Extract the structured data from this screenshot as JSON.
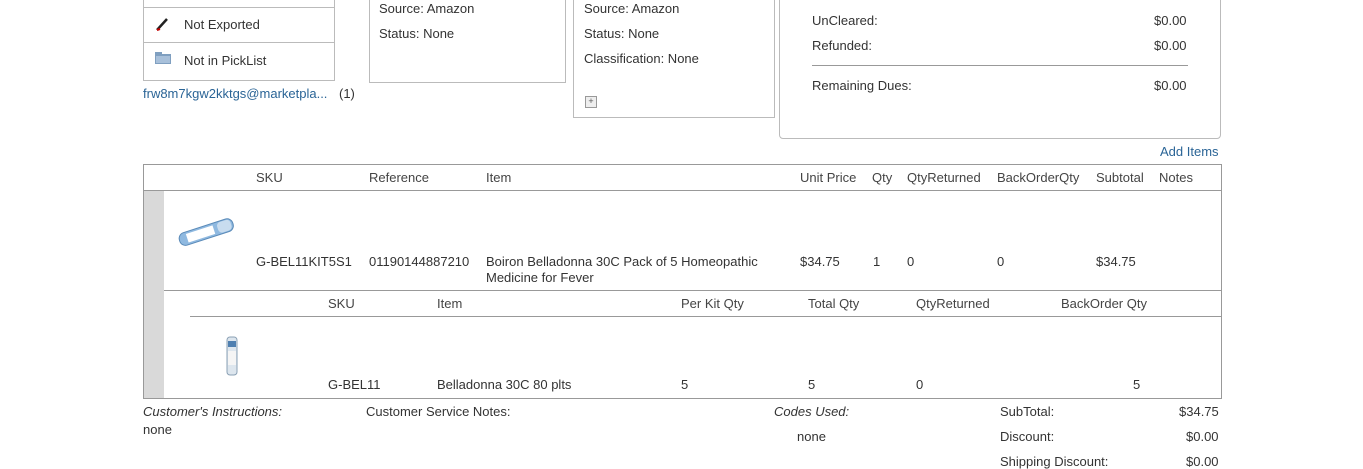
{
  "export_menu": {
    "items": [
      {
        "label": "Not Exported",
        "icon": "pencil-icon"
      },
      {
        "label": "Not in PickList",
        "icon": "folder-icon"
      }
    ],
    "email": "frw8m7kgw2kktgs@marketpla...",
    "email_count": "(1)"
  },
  "order_box": {
    "source": "Source: Amazon",
    "status": "Status: None"
  },
  "customer_box": {
    "source": "Source: Amazon",
    "status": "Status: None",
    "classification": "Classification: None",
    "expand": "+"
  },
  "payment_box": {
    "rows": [
      {
        "label": "UnCleared:",
        "value": "$0.00"
      },
      {
        "label": "Refunded:",
        "value": "$0.00"
      }
    ],
    "remaining_label": "Remaining Dues:",
    "remaining_value": "$0.00"
  },
  "add_items": "Add Items",
  "items_table": {
    "headers": {
      "sku": "SKU",
      "reference": "Reference",
      "item": "Item",
      "unit_price": "Unit Price",
      "qty": "Qty",
      "qty_returned": "QtyReturned",
      "backorder_qty": "BackOrderQty",
      "subtotal": "Subtotal",
      "notes": "Notes"
    },
    "row": {
      "sku": "G-BEL11KIT5S1",
      "reference": "01190144887210",
      "item_line1": "Boiron Belladonna 30C Pack of 5 Homeopathic",
      "item_line2": "Medicine for Fever",
      "unit_price": "$34.75",
      "qty": "1",
      "qty_returned": "0",
      "backorder_qty": "0",
      "subtotal": "$34.75"
    },
    "kit_headers": {
      "sku": "SKU",
      "item": "Item",
      "per_kit_qty": "Per Kit Qty",
      "total_qty": "Total Qty",
      "qty_returned": "QtyReturned",
      "backorder_qty": "BackOrder Qty"
    },
    "kit_row": {
      "sku": "G-BEL11",
      "item": "Belladonna 30C 80 plts",
      "per_kit_qty": "5",
      "total_qty": "5",
      "qty_returned": "0",
      "backorder_qty": "5"
    }
  },
  "footer": {
    "customer_instructions_label": "Customer's Instructions:",
    "customer_instructions_value": "none",
    "service_notes_label": "Customer Service Notes:",
    "codes_used_label": "Codes Used:",
    "codes_used_value": "none",
    "totals": [
      {
        "label": "SubTotal:",
        "value": "$34.75"
      },
      {
        "label": "Discount:",
        "value": "$0.00"
      },
      {
        "label": "Shipping Discount:",
        "value": "$0.00"
      }
    ]
  }
}
